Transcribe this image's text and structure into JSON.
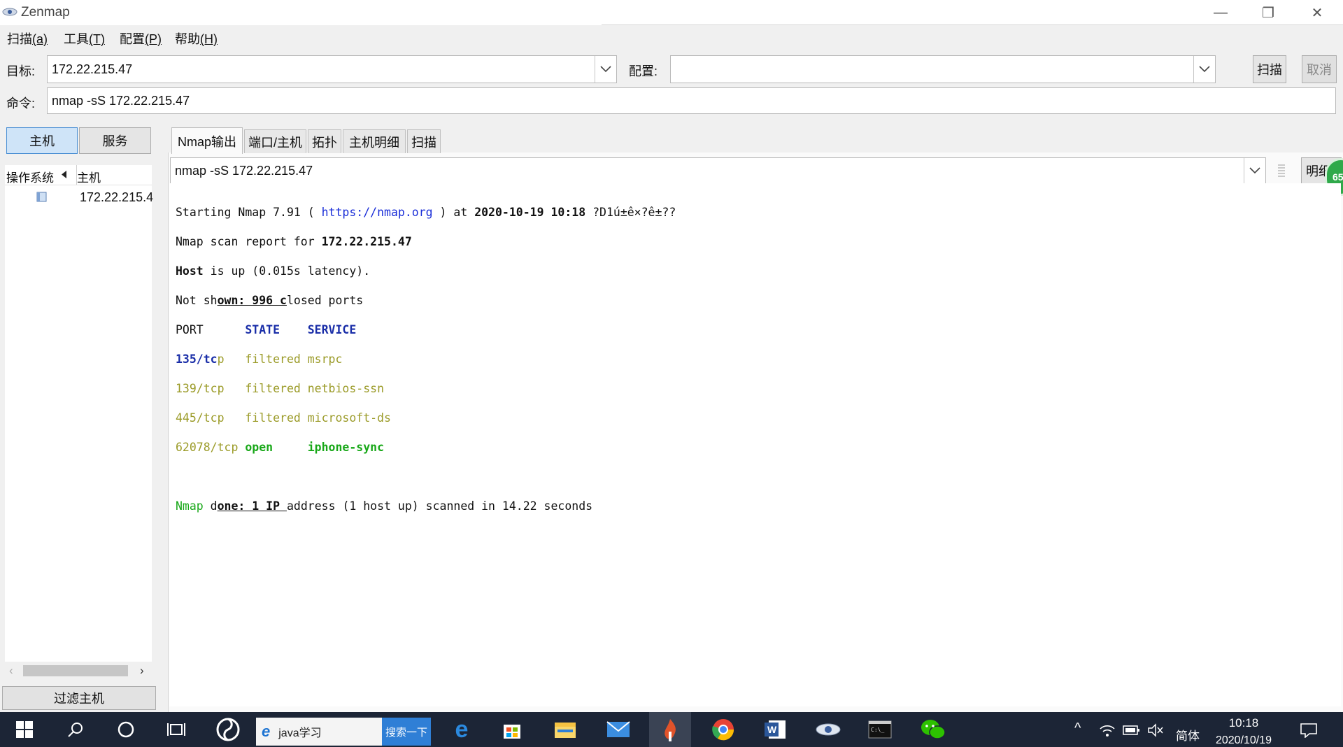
{
  "window": {
    "title": "Zenmap",
    "min": "—",
    "restore": "❐",
    "close": "✕"
  },
  "menu": [
    {
      "label": "扫描",
      "key": "(a)"
    },
    {
      "label": "工具",
      "key": "(T)"
    },
    {
      "label": "配置",
      "key": "(P)"
    },
    {
      "label": "帮助",
      "key": "(H)"
    }
  ],
  "target": {
    "label": "目标:",
    "value": "172.22.215.47"
  },
  "profile": {
    "label": "配置:",
    "value": ""
  },
  "scan_button": "扫描",
  "cancel_button": "取消",
  "command": {
    "label": "命令:",
    "value": "nmap -sS 172.22.215.47"
  },
  "left": {
    "hosts_button": "主机",
    "services_button": "服务",
    "col_os": "操作系统",
    "col_host": "主机",
    "hosts": [
      "172.22.215.4"
    ],
    "filter_button": "过滤主机"
  },
  "tabs": [
    "Nmap输出",
    "端口/主机",
    "拓扑",
    "主机明细",
    "扫描"
  ],
  "output_select": "nmap -sS 172.22.215.47",
  "detail_button": "明细",
  "badge": "65",
  "output": {
    "l1_a": "Starting Nmap 7.91 ( ",
    "l1_link": "https://nmap.org",
    "l1_b": " ) at ",
    "l1_date": "2020-10-19 10:18 ",
    "l1_c": "?D1ú±ê×?ê±??",
    "l2_a": "Nmap scan report for ",
    "l2_ip": "172.22.215.47",
    "l3_a": "Host",
    "l3_b": " is up (0.015s latency).",
    "l4_a": "Not sh",
    "l4_b": "own: 996 c",
    "l4_c": "losed ports",
    "hdr_port": "PORT      ",
    "hdr_state": "STATE    ",
    "hdr_service": "SERVICE",
    "p1_port": "135/tc",
    "p1_p": "p",
    "p1_rest": "   filtered msrpc",
    "p2_port": "139/tcp",
    "p2_rest": "   filtered netbios-ssn",
    "p3_port": "445/tcp",
    "p3_rest": "   filtered microsoft-ds",
    "p4_port": "62078/tcp",
    "p4_state": " open     ",
    "p4_service": "iphone-sync",
    "done_a": "Nmap",
    "done_b": " d",
    "done_c": "one: 1 IP ",
    "done_d": "address (1 host up) scanned in 14.22 seconds"
  },
  "taskbar": {
    "search_text": "java学习",
    "search_button": "搜索一下",
    "ime": "简体",
    "time": "10:18",
    "date": "2020/10/19"
  }
}
